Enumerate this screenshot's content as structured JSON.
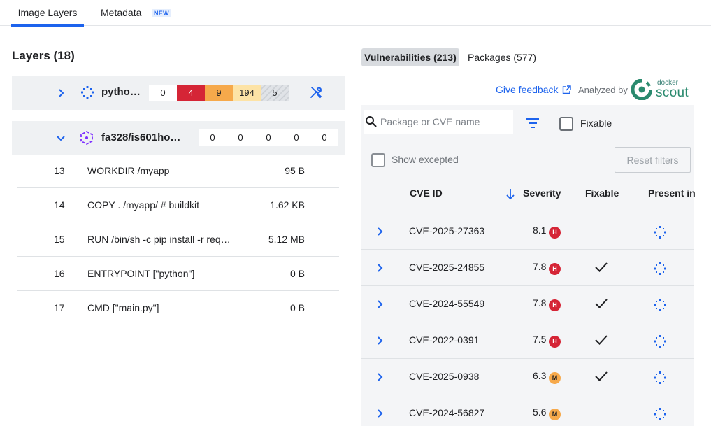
{
  "tabs": {
    "image_layers": "Image Layers",
    "metadata": "Metadata",
    "metadata_badge": "NEW"
  },
  "layers": {
    "title": "Layers (18)",
    "images": [
      {
        "name": "pytho…",
        "expanded": false,
        "counts": [
          "0",
          "4",
          "9",
          "194",
          "5"
        ]
      },
      {
        "name": "fa328/is601ho…",
        "expanded": true,
        "counts": [
          "0",
          "0",
          "0",
          "0",
          "0"
        ]
      }
    ],
    "rows": [
      {
        "num": "13",
        "cmd": "WORKDIR /myapp",
        "size": "95 B"
      },
      {
        "num": "14",
        "cmd": "COPY . /myapp/ # buildkit",
        "size": "1.62 KB"
      },
      {
        "num": "15",
        "cmd": "RUN /bin/sh -c pip install -r req…",
        "size": "5.12 MB"
      },
      {
        "num": "16",
        "cmd": "ENTRYPOINT [\"python\"]",
        "size": "0 B"
      },
      {
        "num": "17",
        "cmd": "CMD [\"main.py\"]",
        "size": "0 B"
      }
    ]
  },
  "right": {
    "tab_vulnerabilities": "Vulnerabilities (213)",
    "tab_packages": "Packages (577)",
    "give_feedback": "Give feedback",
    "analyzed_by": "Analyzed by",
    "docker_word": "docker",
    "scout_word": "scout",
    "search_placeholder": "Package or CVE name",
    "fixable_label": "Fixable",
    "show_excepted_label": "Show excepted",
    "reset_filters": "Reset filters",
    "columns": {
      "cve_id": "CVE ID",
      "severity": "Severity",
      "fixable": "Fixable",
      "present_in": "Present in"
    },
    "vulns": [
      {
        "id": "CVE-2025-27363",
        "score": "8.1",
        "sev": "H",
        "fixable": false
      },
      {
        "id": "CVE-2025-24855",
        "score": "7.8",
        "sev": "H",
        "fixable": true
      },
      {
        "id": "CVE-2024-55549",
        "score": "7.8",
        "sev": "H",
        "fixable": true
      },
      {
        "id": "CVE-2022-0391",
        "score": "7.5",
        "sev": "H",
        "fixable": true
      },
      {
        "id": "CVE-2025-0938",
        "score": "6.3",
        "sev": "M",
        "fixable": true
      },
      {
        "id": "CVE-2024-56827",
        "score": "5.6",
        "sev": "M",
        "fixable": false
      }
    ]
  },
  "colors": {
    "accent": "#1d63ed",
    "critical": "#d52536",
    "high": "#f6a94b",
    "medium": "#fde3a6",
    "scout_green": "#2a8a6e"
  }
}
